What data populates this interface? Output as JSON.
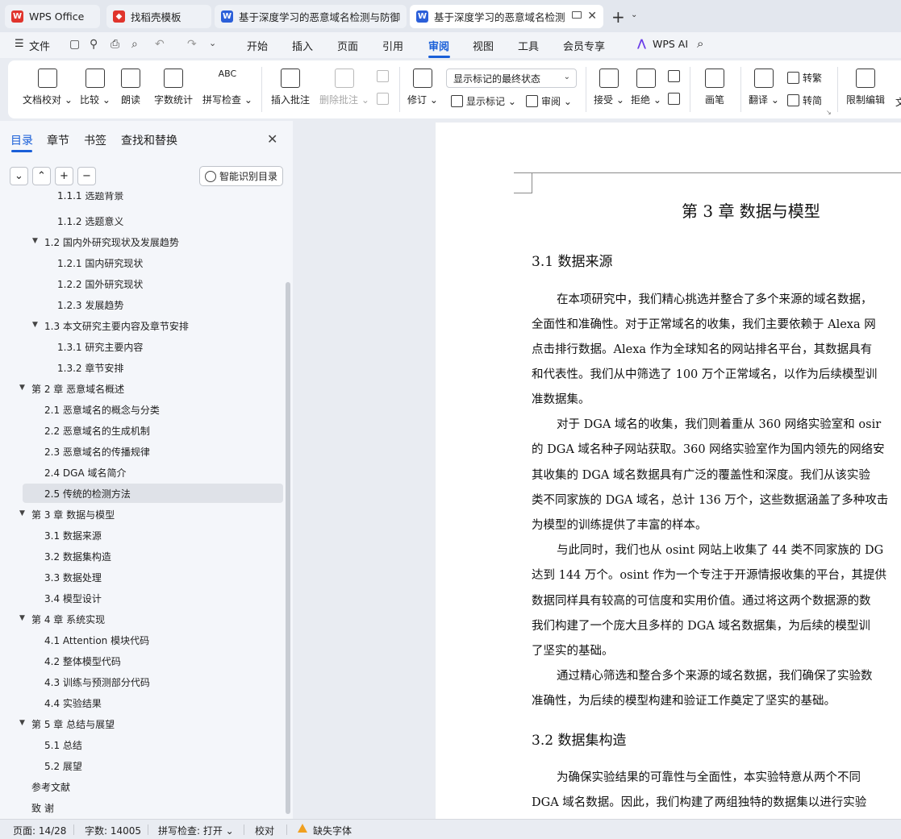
{
  "tabs": [
    {
      "label": "WPS Office",
      "color": "#e0342c"
    },
    {
      "label": "找稻壳模板",
      "color": "#e0342c"
    },
    {
      "label": "基于深度学习的恶意域名检测与防御系",
      "color": "#2b5fd9"
    },
    {
      "label": "基于深度学习的恶意域名检测与",
      "color": "#2b5fd9"
    }
  ],
  "menu": {
    "file": "文件",
    "items": [
      "开始",
      "插入",
      "页面",
      "引用",
      "审阅",
      "视图",
      "工具",
      "会员专享"
    ],
    "active": "审阅",
    "wps_ai": "WPS AI"
  },
  "ribbon": {
    "doc_check": "文档校对",
    "compare": "比较",
    "read_aloud": "朗读",
    "word_count": "字数统计",
    "spell_check": "拼写检查",
    "insert_comment": "插入批注",
    "delete_comment": "删除批注",
    "track": "修订",
    "markup_select": "显示标记的最终状态",
    "show_markup": "显示标记",
    "review": "审阅",
    "accept": "接受",
    "reject": "拒绝",
    "pen": "画笔",
    "translate": "翻译",
    "to_traditional": "转繁",
    "to_simplified": "转简",
    "restrict_edit": "限制编辑",
    "cut_char": "文"
  },
  "nav": {
    "tabs": [
      "目录",
      "章节",
      "书签",
      "查找和替换"
    ],
    "smart_btn": "智能识别目录",
    "buttons": [
      "⌄",
      "⌃",
      "+",
      "−"
    ],
    "toc": [
      {
        "text": "1.1.1  选题背景"
      },
      {
        "text": "1.1.2  选题意义"
      },
      {
        "text": "1.2  国内外研究现状及发展趋势"
      },
      {
        "text": "1.2.1  国内研究现状"
      },
      {
        "text": "1.2.2  国外研究现状"
      },
      {
        "text": "1.2.3  发展趋势"
      },
      {
        "text": "1.3  本文研究主要内容及章节安排"
      },
      {
        "text": "1.3.1  研究主要内容"
      },
      {
        "text": "1.3.2  章节安排"
      },
      {
        "text": "第 2 章  恶意域名概述"
      },
      {
        "text": "2.1  恶意域名的概念与分类"
      },
      {
        "text": "2.2  恶意域名的生成机制"
      },
      {
        "text": "2.3  恶意域名的传播规律"
      },
      {
        "text": "2.4 DGA 域名简介"
      },
      {
        "text": "2.5  传统的检测方法"
      },
      {
        "text": "第 3 章  数据与模型"
      },
      {
        "text": "3.1  数据来源"
      },
      {
        "text": "3.2  数据集构造"
      },
      {
        "text": "3.3  数据处理"
      },
      {
        "text": "3.4  模型设计"
      },
      {
        "text": "第 4 章  系统实现"
      },
      {
        "text": "4.1 Attention 模块代码"
      },
      {
        "text": "4.2  整体模型代码"
      },
      {
        "text": "4.3  训练与预测部分代码"
      },
      {
        "text": "4.4  实验结果"
      },
      {
        "text": "第 5 章  总结与展望"
      },
      {
        "text": "5.1  总结"
      },
      {
        "text": "5.2  展望"
      },
      {
        "text": "参考文献"
      },
      {
        "text": "致    谢"
      }
    ]
  },
  "document": {
    "title": "第 3 章  数据与模型",
    "h2_1": "3.1  数据来源",
    "h2_2": "3.2  数据集构造",
    "lines": [
      "在本项研究中，我们精心挑选并整合了多个来源的域名数据，",
      "全面性和准确性。对于正常域名的收集，我们主要依赖于 Alexa 网",
      "点击排行数据。Alexa 作为全球知名的网站排名平台，其数据具有",
      "和代表性。我们从中筛选了 100 万个正常域名，以作为后续模型训",
      "准数据集。",
      "对于 DGA 域名的收集，我们则着重从 360 网络实验室和 osir",
      "的 DGA 域名种子网站获取。360 网络实验室作为国内领先的网络安",
      "其收集的 DGA 域名数据具有广泛的覆盖性和深度。我们从该实验",
      "类不同家族的 DGA 域名，总计 136 万个，这些数据涵盖了多种攻击",
      "为模型的训练提供了丰富的样本。",
      "与此同时，我们也从 osint 网站上收集了 44 类不同家族的 DG",
      "达到 144 万个。osint 作为一个专注于开源情报收集的平台，其提供",
      "数据同样具有较高的可信度和实用价值。通过将这两个数据源的数",
      "我们构建了一个庞大且多样的 DGA 域名数据集，为后续的模型训",
      "了坚实的基础。",
      "通过精心筛选和整合多个来源的域名数据，我们确保了实验数",
      "准确性，为后续的模型构建和验证工作奠定了坚实的基础。",
      "为确保实验结果的可靠性与全面性，本实验特意从两个不同",
      "DGA 域名数据。因此，我们构建了两组独特的数据集以进行实验"
    ]
  },
  "status": {
    "page": "页面: 14/28",
    "words": "字数: 14005",
    "spell": "拼写检查: 打开",
    "proof": "校对",
    "missing_font": "缺失字体"
  }
}
